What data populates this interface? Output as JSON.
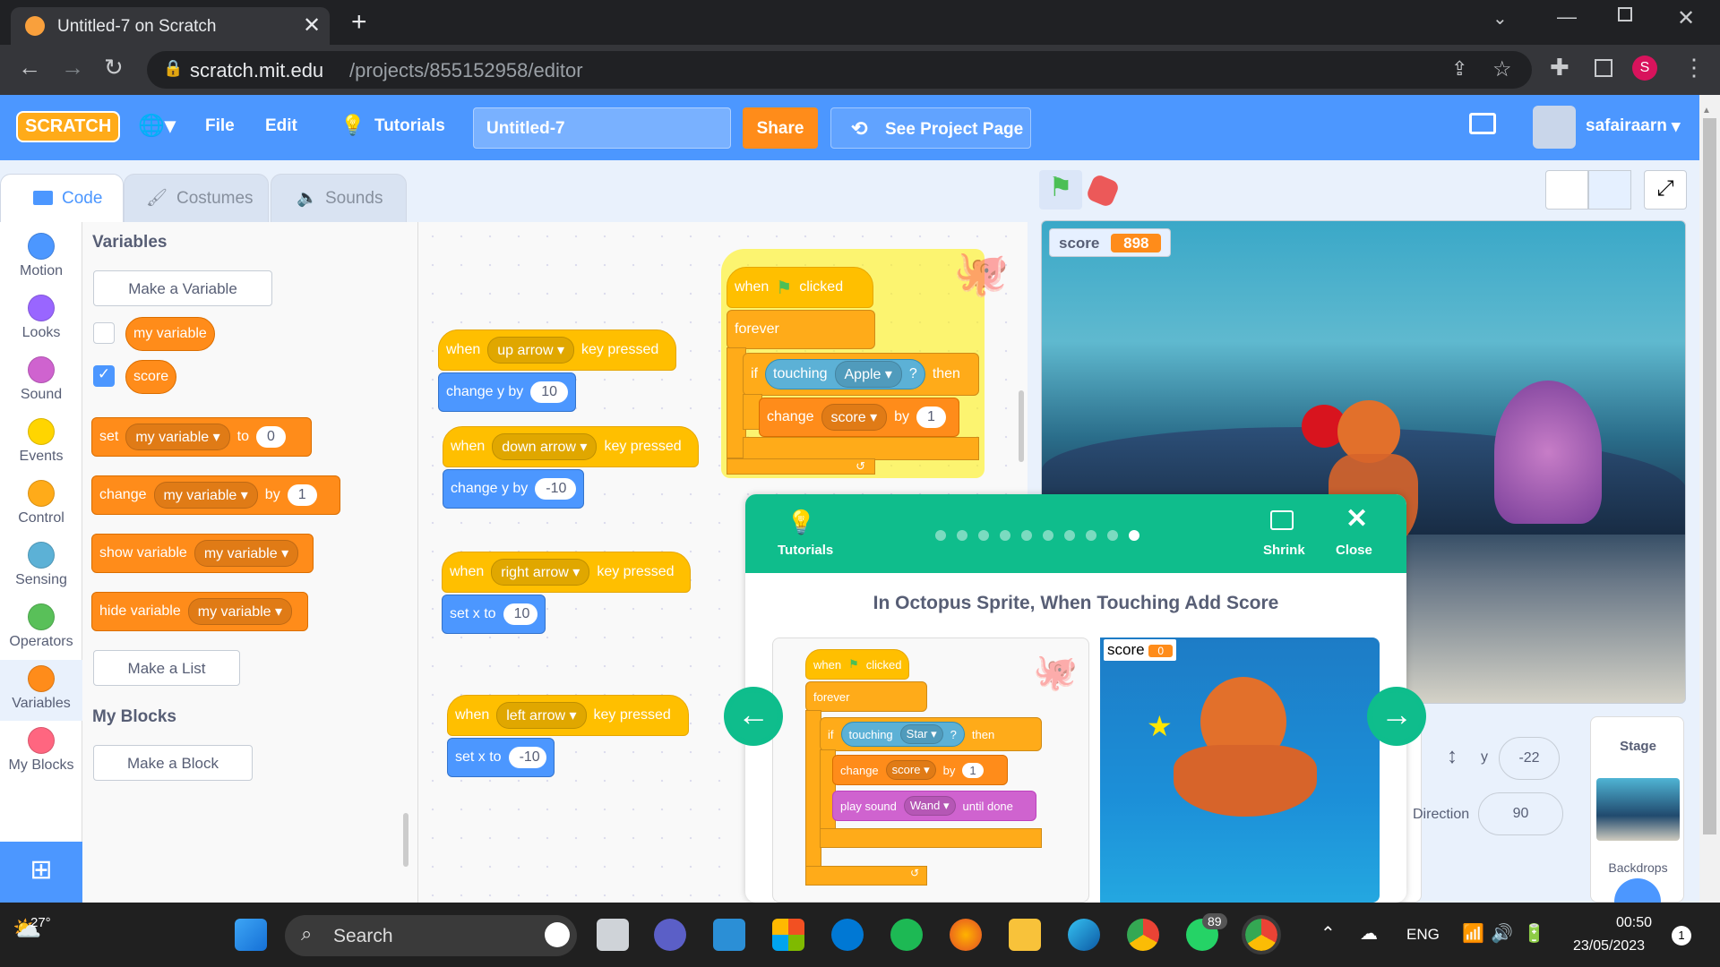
{
  "browser": {
    "tab_title": "Untitled-7 on Scratch",
    "url_host": "scratch.mit.edu",
    "url_path": "/projects/855152958/editor",
    "profile_initial": "S"
  },
  "menu": {
    "logo": "SCRATCH",
    "file": "File",
    "edit": "Edit",
    "tutorials": "Tutorials",
    "project_title": "Untitled-7",
    "share": "Share",
    "see_project": "See Project Page",
    "username": "safairaarn"
  },
  "editor_tabs": {
    "code": "Code",
    "costumes": "Costumes",
    "sounds": "Sounds"
  },
  "categories": [
    {
      "label": "Motion",
      "color": "#4c97ff"
    },
    {
      "label": "Looks",
      "color": "#9966ff"
    },
    {
      "label": "Sound",
      "color": "#cf63cf"
    },
    {
      "label": "Events",
      "color": "#ffd500"
    },
    {
      "label": "Control",
      "color": "#ffab19"
    },
    {
      "label": "Sensing",
      "color": "#5cb1d6"
    },
    {
      "label": "Operators",
      "color": "#59c059"
    },
    {
      "label": "Variables",
      "color": "#ff8c1a"
    },
    {
      "label": "My Blocks",
      "color": "#ff6680"
    }
  ],
  "palette": {
    "heading": "Variables",
    "make_variable": "Make a Variable",
    "var1": "my variable",
    "var2": "score",
    "set": "set",
    "to": "to",
    "set_val": "0",
    "change": "change",
    "by": "by",
    "change_val": "1",
    "show_variable": "show variable",
    "hide_variable": "hide variable",
    "make_list": "Make a List",
    "myblocks_heading": "My Blocks",
    "make_block": "Make a Block"
  },
  "scripts": {
    "when": "when",
    "key_pressed": "key pressed",
    "up": "up arrow",
    "down": "down arrow",
    "right": "right arrow",
    "left": "left arrow",
    "change_y_by": "change y by",
    "set_x_to": "set x to",
    "v_up": "10",
    "v_down": "-10",
    "v_right": "10",
    "v_left": "-10",
    "when_clicked_a": "when",
    "clicked": "clicked",
    "forever": "forever",
    "if": "if",
    "touching": "touching",
    "apple": "Apple",
    "q": "?",
    "then": "then",
    "change": "change",
    "score": "score",
    "by": "by",
    "one": "1"
  },
  "stage": {
    "monitor_label": "score",
    "monitor_value": "898",
    "y_label": "y",
    "y_value": "-22",
    "direction_label": "Direction",
    "direction_value": "90",
    "stage_label": "Stage",
    "backdrops_label": "Backdrops"
  },
  "tutorial": {
    "label": "Tutorials",
    "shrink": "Shrink",
    "close": "Close",
    "title": "In Octopus Sprite, When Touching Add Score",
    "when": "when",
    "clicked": "clicked",
    "forever": "forever",
    "if": "if",
    "touching": "touching",
    "star": "Star",
    "q": "?",
    "then": "then",
    "change": "change",
    "score": "score",
    "by": "by",
    "one": "1",
    "play_sound": "play sound",
    "wand": "Wand",
    "until_done": "until done",
    "mini_score_label": "score",
    "mini_score_value": "0",
    "step_count": 10,
    "active_step": 9
  },
  "taskbar": {
    "temp": "27°",
    "search": "Search",
    "whatsapp_badge": "89",
    "lang": "ENG",
    "time": "00:50",
    "date": "23/05/2023",
    "notif": "1"
  }
}
